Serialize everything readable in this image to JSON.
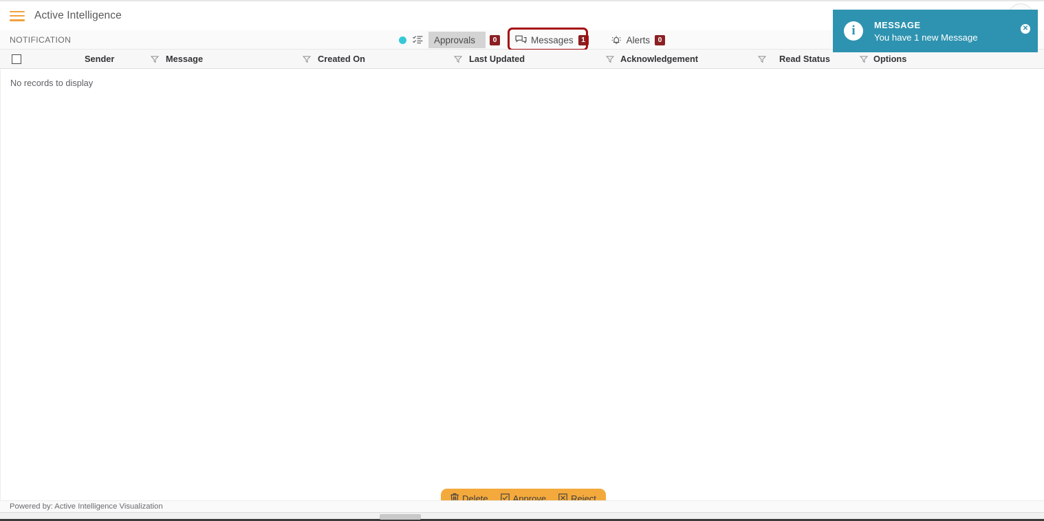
{
  "app": {
    "title": "Active Intelligence",
    "menu_icon": "hamburger-icon",
    "avatar_icon": "user-avatar-icon"
  },
  "notification_bar": {
    "label": "NOTIFICATION",
    "status_dot_color": "#37c8d8",
    "list_icon": "checklist-icon",
    "tabs": [
      {
        "label": "Approvals",
        "count": "0",
        "icon": "",
        "active": true
      },
      {
        "label": "Messages",
        "count": "1",
        "icon": "chat-bubbles-icon",
        "active": false,
        "highlighted": true
      },
      {
        "label": "Alerts",
        "count": "0",
        "icon": "bell-icon",
        "active": false
      }
    ],
    "badge_color": "#8b1f22",
    "highlight_color": "#a50d12"
  },
  "grid": {
    "select_all_checkbox": "unchecked",
    "columns": [
      {
        "label": "Sender",
        "filterable": false
      },
      {
        "label": "Message",
        "filterable": true
      },
      {
        "label": "Created On",
        "filterable": true
      },
      {
        "label": "Last Updated",
        "filterable": true
      },
      {
        "label": "Acknowledgement",
        "filterable": true
      },
      {
        "label": "Read Status",
        "filterable": true
      },
      {
        "label": "Options",
        "filterable": true
      }
    ],
    "empty_message": "No records to display"
  },
  "action_bar": {
    "buttons": [
      {
        "label": "Delete",
        "icon": "trash-icon"
      },
      {
        "label": "Approve",
        "icon": "checkbox-check-icon"
      },
      {
        "label": "Reject",
        "icon": "checkbox-x-icon"
      }
    ],
    "color": "#f4a93c"
  },
  "footer": {
    "text": "Powered by: Active Intelligence Visualization"
  },
  "toast": {
    "title": "MESSAGE",
    "message": "You have 1 new Message",
    "icon": "info-icon",
    "close_icon": "close-icon",
    "color": "#2e93b0"
  }
}
